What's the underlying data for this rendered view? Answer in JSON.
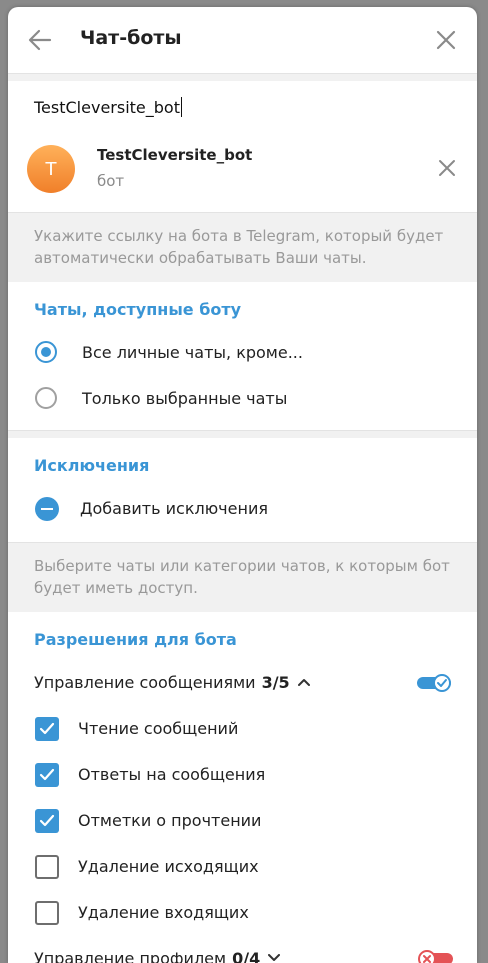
{
  "header": {
    "title": "Чат-боты"
  },
  "bot_input": {
    "value": "TestCleversite_bot"
  },
  "bot": {
    "avatar_letter": "T",
    "name": "TestCleversite_bot",
    "subtitle": "бот"
  },
  "hint1": "Укажите ссылку на бота в Telegram, который будет автоматически обрабатывать Ваши чаты.",
  "chats": {
    "title": "Чаты, доступные боту",
    "options": [
      {
        "label": "Все личные чаты, кроме...",
        "selected": true
      },
      {
        "label": "Только выбранные чаты",
        "selected": false
      }
    ]
  },
  "exceptions": {
    "title": "Исключения",
    "add_label": "Добавить исключения"
  },
  "hint2": "Выберите чаты или категории чатов, к которым бот будет иметь доступ.",
  "permissions": {
    "title": "Разрешения для бота",
    "messages_group": {
      "label": "Управление сообщениями",
      "count": "3/5",
      "enabled": true
    },
    "items": [
      {
        "label": "Чтение сообщений",
        "checked": true
      },
      {
        "label": "Ответы на сообщения",
        "checked": true
      },
      {
        "label": "Отметки о прочтении",
        "checked": true
      },
      {
        "label": "Удаление исходящих",
        "checked": false
      },
      {
        "label": "Удаление входящих",
        "checked": false
      }
    ],
    "profile_group": {
      "label": "Управление профилем",
      "count": "0/4",
      "enabled": false
    }
  },
  "colors": {
    "accent": "#3a95d5",
    "danger": "#e45356"
  }
}
